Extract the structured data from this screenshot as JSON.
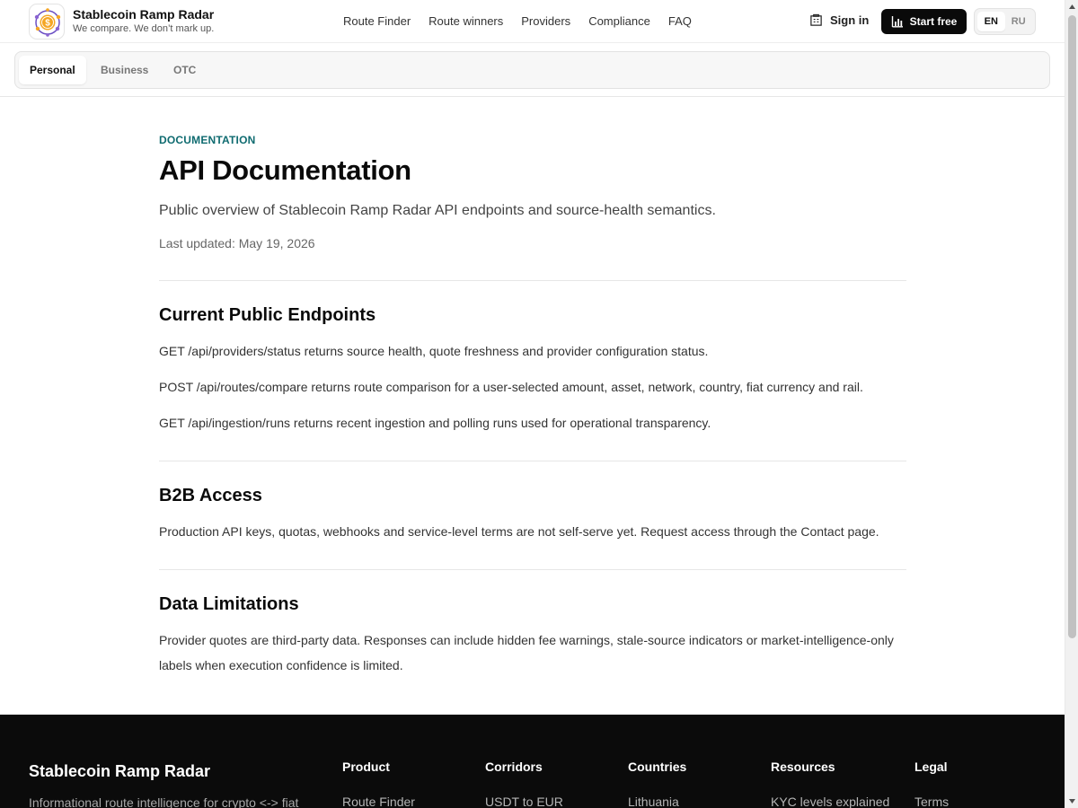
{
  "header": {
    "brand_name": "Stablecoin Ramp Radar",
    "brand_tagline": "We compare. We don’t mark up.",
    "logo_icon": "coin-radar-logo",
    "nav": [
      "Route Finder",
      "Route winners",
      "Providers",
      "Compliance",
      "FAQ"
    ],
    "signin_label": "Sign in",
    "signin_icon": "building-icon",
    "start_label": "Start free",
    "start_icon": "bar-chart-icon",
    "languages": [
      "EN",
      "RU"
    ],
    "active_language": "EN"
  },
  "segments": {
    "items": [
      "Personal",
      "Business",
      "OTC"
    ],
    "active": "Personal"
  },
  "page": {
    "eyebrow": "DOCUMENTATION",
    "title": "API Documentation",
    "subtitle": "Public overview of Stablecoin Ramp Radar API endpoints and source-health semantics.",
    "updated": "Last updated: May 19, 2026",
    "sections": [
      {
        "heading": "Current Public Endpoints",
        "paragraphs": [
          "GET /api/providers/status returns source health, quote freshness and provider configuration status.",
          "POST /api/routes/compare returns route comparison for a user-selected amount, asset, network, country, fiat currency and rail.",
          "GET /api/ingestion/runs returns recent ingestion and polling runs used for operational transparency."
        ]
      },
      {
        "heading": "B2B Access",
        "paragraphs": [
          "Production API keys, quotas, webhooks and service-level terms are not self-serve yet. Request access through the Contact page."
        ]
      },
      {
        "heading": "Data Limitations",
        "paragraphs": [
          "Provider quotes are third-party data. Responses can include hidden fee warnings, stale-source indicators or market-intelligence-only labels when execution confidence is limited."
        ]
      }
    ]
  },
  "footer": {
    "brand": "Stablecoin Ramp Radar",
    "description": "Informational route intelligence for crypto <-> fiat",
    "columns": [
      {
        "heading": "Product",
        "first_link": "Route Finder"
      },
      {
        "heading": "Corridors",
        "first_link": "USDT to EUR"
      },
      {
        "heading": "Countries",
        "first_link": "Lithuania"
      },
      {
        "heading": "Resources",
        "first_link": "KYC levels explained"
      },
      {
        "heading": "Legal",
        "first_link": "Terms"
      }
    ]
  },
  "colors": {
    "accent": "#0f6b70",
    "footer_bg": "#0b0b0b",
    "primary_button": "#0a0a0a"
  }
}
